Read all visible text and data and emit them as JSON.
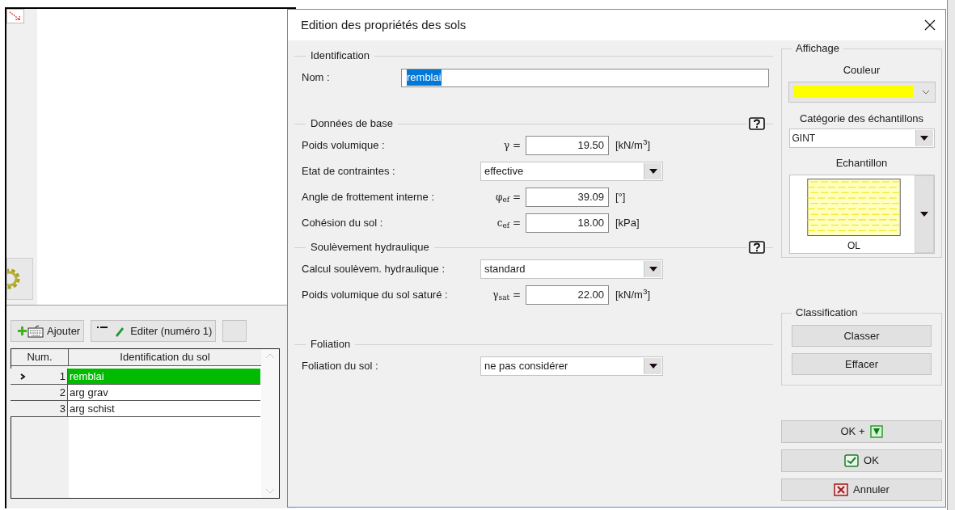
{
  "background": {
    "toolbar": [
      {
        "label": "Ajouter",
        "kind": "add"
      },
      {
        "label": "Editer (numéro 1)",
        "kind": "edit"
      }
    ],
    "table": {
      "columns": [
        "Num.",
        "Identification du sol"
      ],
      "rows": [
        {
          "num": "1",
          "name": "remblai",
          "selected": true
        },
        {
          "num": "2",
          "name": "arg grav",
          "selected": false
        },
        {
          "num": "3",
          "name": "arg schist",
          "selected": false
        }
      ]
    }
  },
  "dialog": {
    "title": "Edition des propriétés des sols",
    "sections": [
      {
        "title": "Identification",
        "help": false,
        "rows": [
          {
            "kind": "text",
            "label": "Nom :",
            "value": "remblai",
            "text_selected": true
          }
        ]
      },
      {
        "title": "Données de base",
        "help": true,
        "rows": [
          {
            "kind": "number",
            "label": "Poids volumique :",
            "symbol": "γ =",
            "value": "19.50",
            "unit": "[kN/m$^{3}$]"
          },
          {
            "kind": "select",
            "label": "Etat de contraintes :",
            "value": "effective"
          },
          {
            "kind": "number",
            "label": "Angle de frottement interne :",
            "symbol": "φ$_{ef}$ =",
            "value": "39.09",
            "unit": "[°]"
          },
          {
            "kind": "number",
            "label": "Cohésion du sol :",
            "symbol": "c$_{ef}$ =",
            "value": "18.00",
            "unit": "[kPa]"
          }
        ]
      },
      {
        "title": "Soulèvement hydraulique",
        "help": true,
        "rows": [
          {
            "kind": "select",
            "label": "Calcul soulèvem. hydraulique :",
            "value": "standard"
          },
          {
            "kind": "number",
            "label": "Poids volumique du sol saturé :",
            "symbol": "γ$_{sat}$ =",
            "value": "22.00",
            "unit": "[kN/m$^{3}$]"
          }
        ]
      },
      {
        "title": "Foliation",
        "help": false,
        "rows": [
          {
            "kind": "select",
            "label": "Foliation du sol :",
            "value": "ne pas considérer"
          }
        ]
      }
    ],
    "display": {
      "title": "Affichage",
      "color_label": "Couleur",
      "color": "#ffff00",
      "category_label": "Catégorie des échantillons",
      "category": "GINT",
      "sample_label": "Echantillon",
      "sample": "OL"
    },
    "classification": {
      "title": "Classification",
      "buttons": [
        "Classer",
        "Effacer"
      ]
    },
    "buttons": [
      {
        "label": "OK +",
        "kind": "ok_next"
      },
      {
        "label": "OK",
        "kind": "ok"
      },
      {
        "label": "Annuler",
        "kind": "cancel"
      }
    ]
  }
}
